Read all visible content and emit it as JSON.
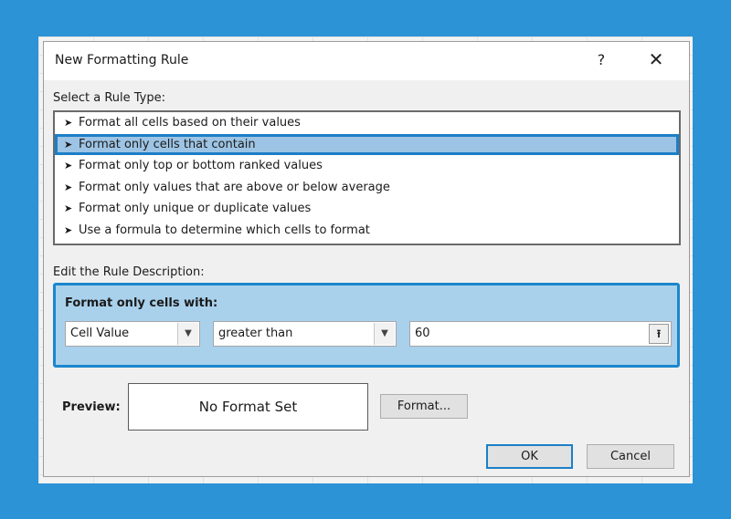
{
  "dialog": {
    "title": "New Formatting Rule",
    "help_glyph": "?",
    "close_glyph": "✕"
  },
  "rule_type": {
    "label": "Select a Rule Type:",
    "items": [
      {
        "label": "Format all cells based on their values",
        "selected": false
      },
      {
        "label": "Format only cells that contain",
        "selected": true
      },
      {
        "label": "Format only top or bottom ranked values",
        "selected": false
      },
      {
        "label": "Format only values that are above or below average",
        "selected": false
      },
      {
        "label": "Format only unique or duplicate values",
        "selected": false
      },
      {
        "label": "Use a formula to determine which cells to format",
        "selected": false
      }
    ],
    "item_icon": "arrow-right-icon"
  },
  "description": {
    "label": "Edit the Rule Description:",
    "box_title": "Format only cells with:",
    "condition_type": "Cell Value",
    "operator": "greater than",
    "value": "60",
    "dropdown_icon": "chevron-down-icon",
    "range_picker_icon": "collapse-range-icon"
  },
  "preview": {
    "label": "Preview:",
    "text": "No Format Set",
    "format_button": "Format..."
  },
  "footer": {
    "ok": "OK",
    "cancel": "Cancel"
  },
  "colors": {
    "background": "#2b93d6",
    "selection": "#9dc4e4",
    "accent_border": "#1b7fc7",
    "description_fill": "#a9d1ec"
  }
}
